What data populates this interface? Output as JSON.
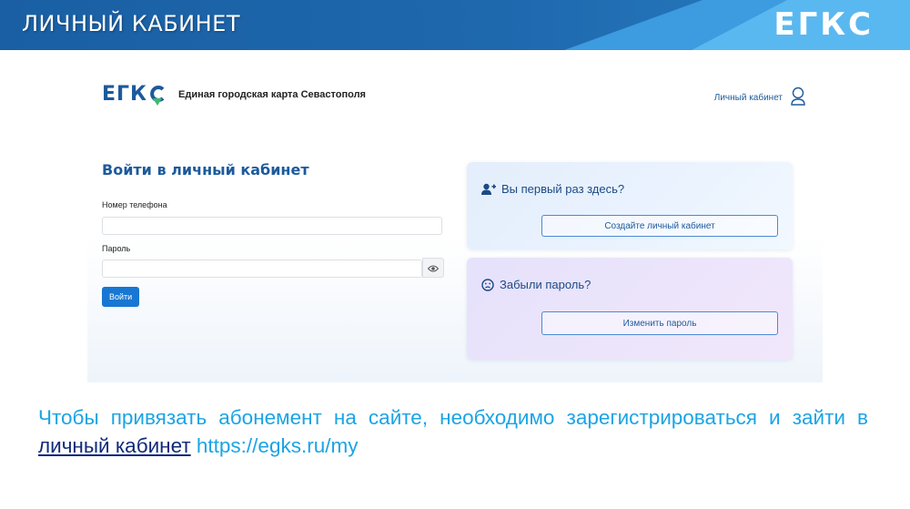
{
  "banner": {
    "title": "ЛИЧНЫЙ КАБИНЕТ",
    "logo": "ЕГКС"
  },
  "site": {
    "logo": "ЕГК",
    "tagline": "Единая городская карта Севастополя",
    "account_link": "Личный кабинет",
    "login": {
      "title": "Войти в личный кабинет",
      "phone_label": "Номер телефона",
      "phone_value": "",
      "password_label": "Пароль",
      "password_value": "",
      "submit_label": "Войти"
    },
    "new_user": {
      "title": "Вы первый раз здесь?",
      "button": "Создайте личный кабинет"
    },
    "forgot": {
      "title": "Забыли пароль?",
      "button": "Изменить пароль"
    }
  },
  "caption": {
    "text_before": "Чтобы привязать абонемент на сайте, необходимо зарегистрироваться и зайти в ",
    "link_text": "личный кабинет",
    "text_after": " https://egks.ru/my"
  },
  "colors": {
    "brand_blue": "#1c5a9c",
    "brand_green": "#3dba6e",
    "caption_blue": "#1ba4e4",
    "button_blue": "#1877d2"
  }
}
